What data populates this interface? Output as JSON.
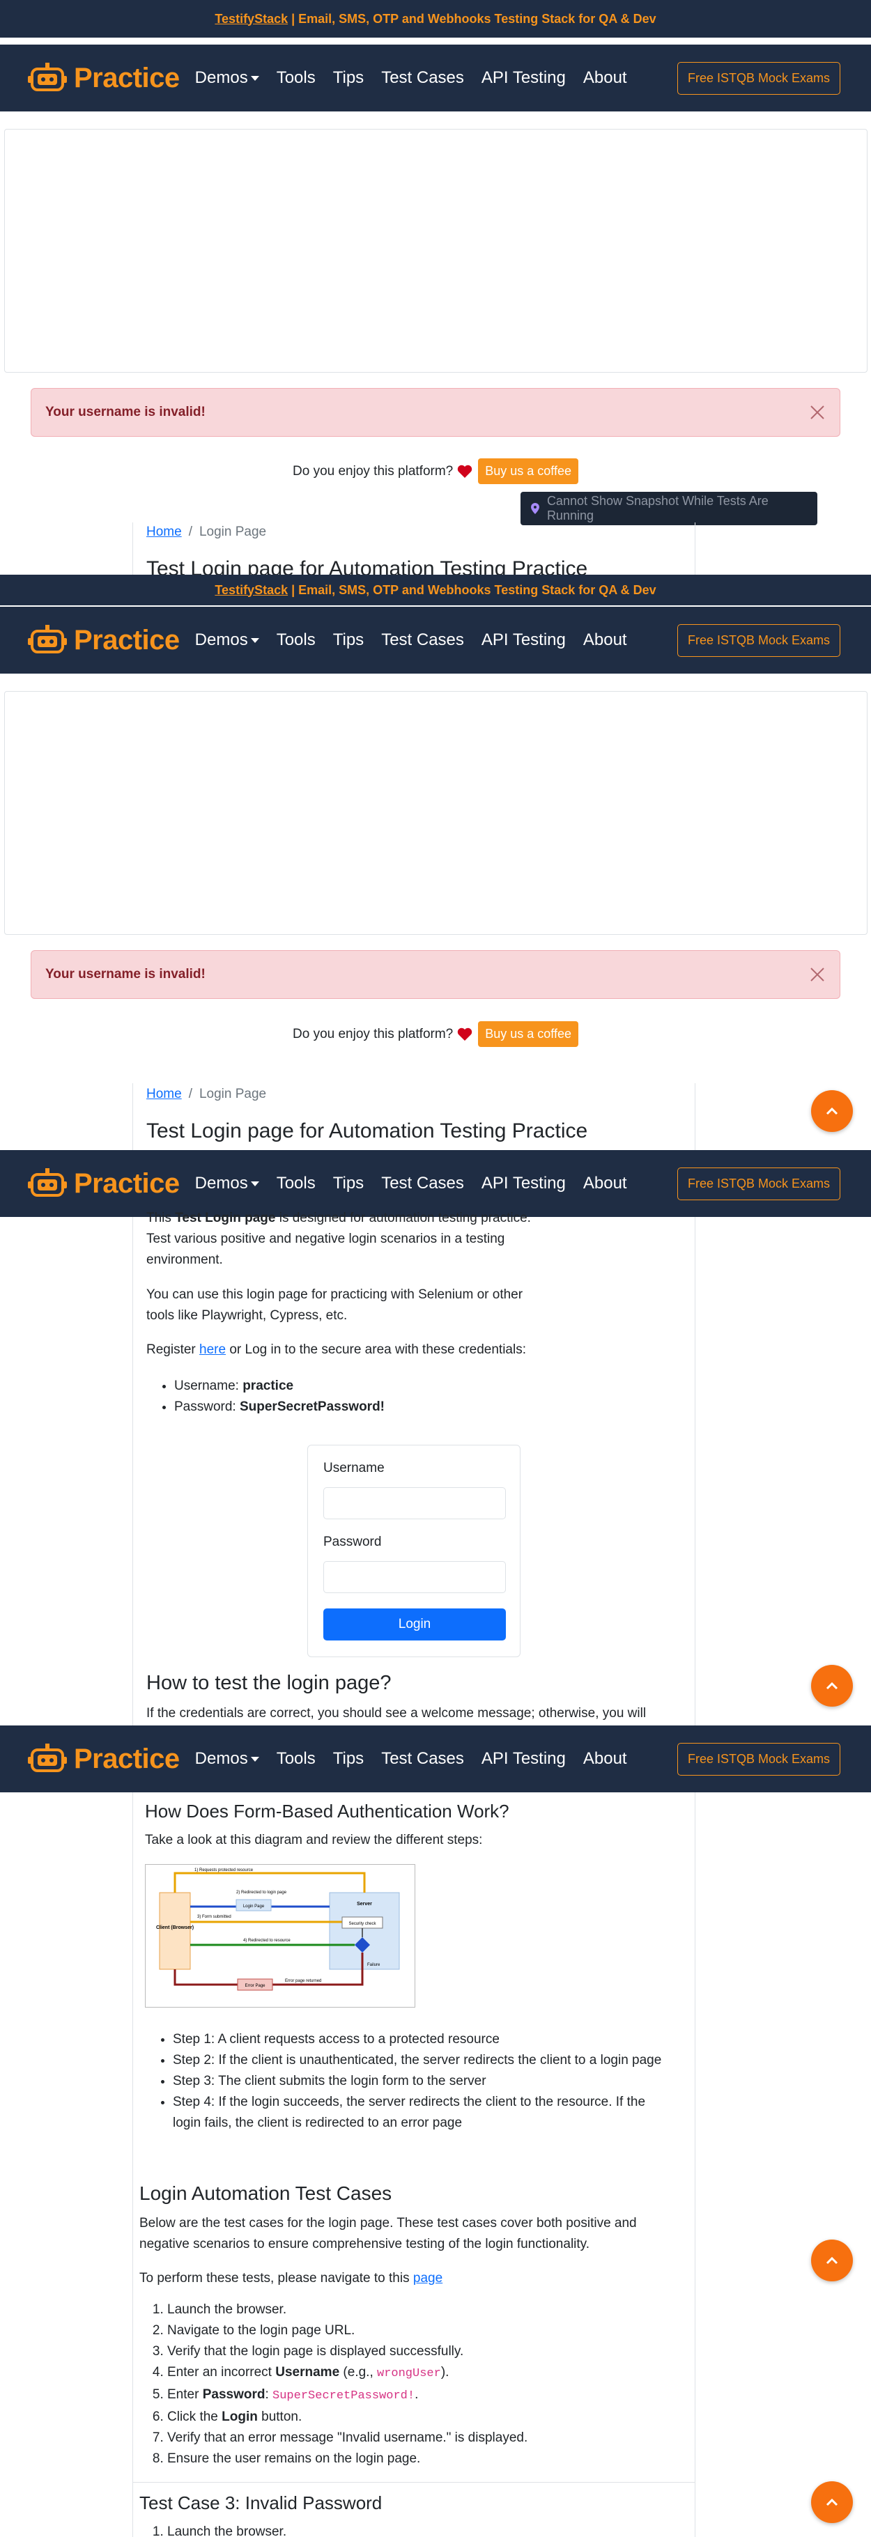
{
  "announcement": {
    "link_text": "TestifyStack",
    "text": "| Email, SMS, OTP and Webhooks Testing Stack for QA & Dev"
  },
  "navbar": {
    "brand": "Practice",
    "links": [
      "Demos",
      "Tools",
      "Tips",
      "Test Cases",
      "API Testing",
      "About"
    ],
    "cta": "Free ISTQB Mock Exams"
  },
  "alert": {
    "message": "Your username is invalid!"
  },
  "support": {
    "question": "Do you enjoy this platform?",
    "button": "Buy us a coffee"
  },
  "snapshot_tooltip": "Cannot Show Snapshot While Tests Are Running",
  "breadcrumb": {
    "home": "Home",
    "separator": "/",
    "current": "Login Page"
  },
  "page_title": "Test Login page for Automation Testing Practice",
  "intro": {
    "p1_pre": "This ",
    "p1_bold": "Test Login page",
    "p1_post": " is designed for automation testing practice. Test various positive and negative login scenarios in a testing environment.",
    "p2": "You can use this login page for practicing with Selenium or other tools like Playwright, Cypress, etc.",
    "p3_pre": "Register ",
    "p3_link": "here",
    "p3_post": " or Log in to the secure area with these credentials:",
    "cred_username_label": "Username: ",
    "cred_username_value": "practice",
    "cred_password_label": "Password: ",
    "cred_password_value": "SuperSecretPassword!"
  },
  "login_form": {
    "username_label": "Username",
    "password_label": "Password",
    "submit": "Login"
  },
  "how_to_test": {
    "title": "How to test the login page?",
    "text": "If the credentials are correct, you should see a welcome message; otherwise, you will"
  },
  "form_auth": {
    "title": "How Does Form-Based Authentication Work?",
    "intro": "Take a look at this diagram and review the different steps:",
    "diagram_labels": {
      "client": "Client (Browser)",
      "server": "Server",
      "requests": "1) Requests protected resource",
      "redirected_login": "2) Redirected to login page",
      "login_page": "Login Page",
      "form_submitted": "3) Form submitted",
      "security_check": "Security check",
      "redirected_resource": "4) Redirected to resource",
      "failure": "Failure",
      "error_page": "Error Page",
      "error_returned": "Error page returned"
    },
    "steps": [
      "Step 1: A client requests access to a protected resource",
      "Step 2: If the client is unauthenticated, the server redirects the client to a login page",
      "Step 3: The client submits the login form to the server",
      "Step 4: If the login succeeds, the server redirects the client to the resource. If the login fails, the client is redirected to an error page"
    ]
  },
  "login_tests": {
    "title": "Login Automation Test Cases",
    "intro": "Below are the test cases for the login page. These test cases cover both positive and negative scenarios to ensure comprehensive testing of the login functionality.",
    "navigate_pre": "To perform these tests, please navigate to this ",
    "navigate_link": "page",
    "steps": {
      "s1": "Launch the browser.",
      "s2": "Navigate to the login page URL.",
      "s3": "Verify that the login page is displayed successfully.",
      "s4_pre": "Enter an incorrect ",
      "s4_bold": "Username",
      "s4_mid": " (e.g., ",
      "s4_code": "wrongUser",
      "s4_post": ").",
      "s5_pre": "Enter ",
      "s5_bold": "Password",
      "s5_mid": ": ",
      "s5_code": "SuperSecretPassword!",
      "s5_post": ".",
      "s6_pre": "Click the ",
      "s6_bold": "Login",
      "s6_post": " button.",
      "s7": "Verify that an error message \"Invalid username.\" is displayed.",
      "s8": "Ensure the user remains on the login page."
    }
  },
  "test_case_3": {
    "title": "Test Case 3: Invalid Password",
    "step1": "Launch the browser."
  },
  "colors": {
    "navy": "#1f2d44",
    "orange": "#f7941d",
    "alert_bg": "#f8d7da",
    "link": "#0d6efd"
  }
}
